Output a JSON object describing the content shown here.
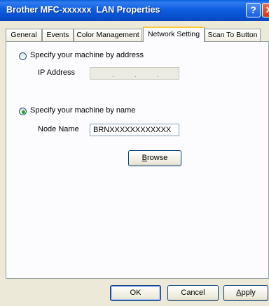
{
  "window": {
    "title": "Brother MFC-xxxxxx  LAN Properties",
    "help_glyph": "?",
    "close_glyph": "✕"
  },
  "tabs": [
    {
      "label": "General",
      "active": false
    },
    {
      "label": "Events",
      "active": false
    },
    {
      "label": "Color Management",
      "active": false
    },
    {
      "label": "Network Setting",
      "active": true
    },
    {
      "label": "Scan To Button",
      "active": false
    }
  ],
  "address_option": {
    "label": "Specify your machine by address",
    "selected": false,
    "ip_label": "IP Address",
    "ip_separator": "."
  },
  "name_option": {
    "label": "Specify your machine by name",
    "selected": true,
    "node_label": "Node Name",
    "node_value": "BRNXXXXXXXXXXXX",
    "browse_label_pre": "",
    "browse_label_accel": "B",
    "browse_label_post": "rowse"
  },
  "footer": {
    "ok": "OK",
    "cancel": "Cancel",
    "apply_accel": "A",
    "apply_post": "pply"
  }
}
